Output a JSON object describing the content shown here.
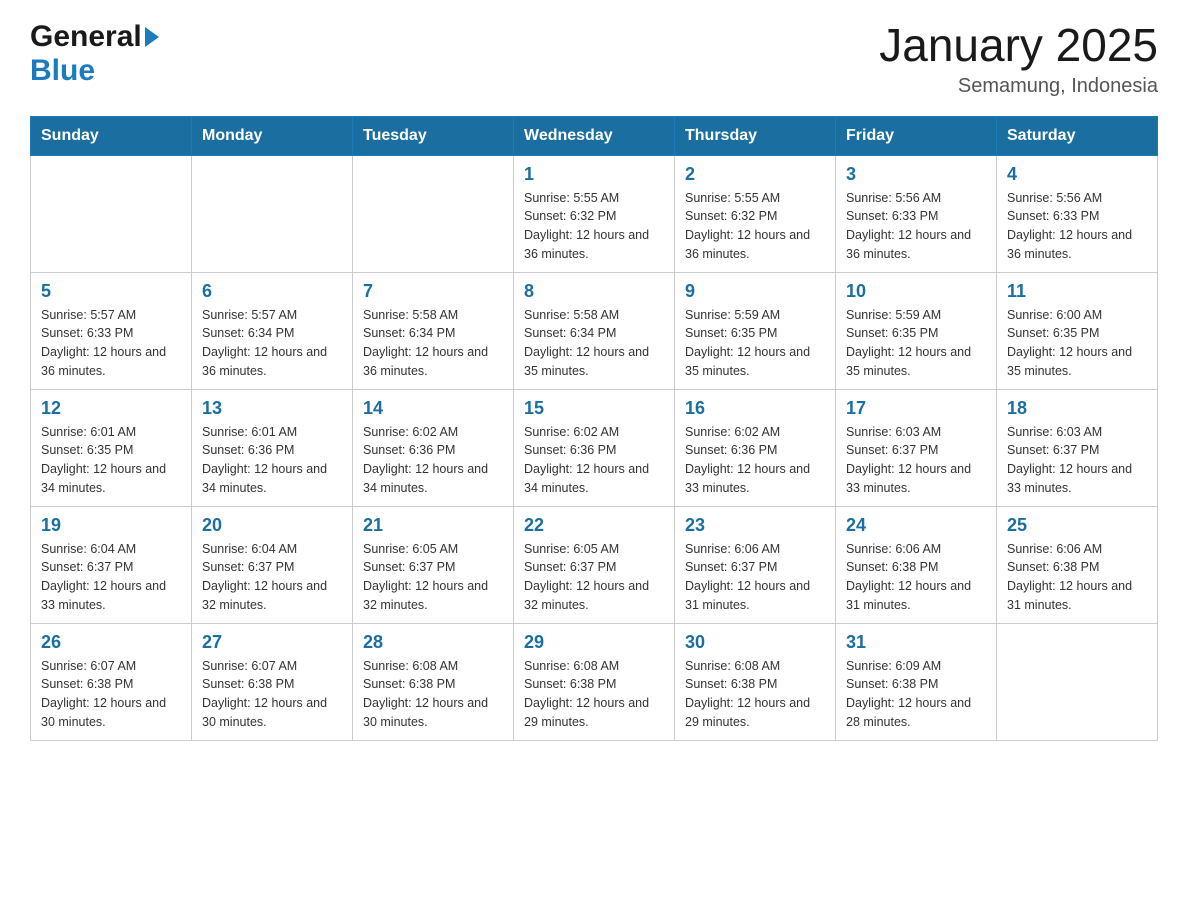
{
  "header": {
    "logo_general": "General",
    "logo_blue": "Blue",
    "title": "January 2025",
    "subtitle": "Semamung, Indonesia"
  },
  "calendar": {
    "days_of_week": [
      "Sunday",
      "Monday",
      "Tuesday",
      "Wednesday",
      "Thursday",
      "Friday",
      "Saturday"
    ],
    "weeks": [
      [
        {
          "day": "",
          "info": ""
        },
        {
          "day": "",
          "info": ""
        },
        {
          "day": "",
          "info": ""
        },
        {
          "day": "1",
          "info": "Sunrise: 5:55 AM\nSunset: 6:32 PM\nDaylight: 12 hours and 36 minutes."
        },
        {
          "day": "2",
          "info": "Sunrise: 5:55 AM\nSunset: 6:32 PM\nDaylight: 12 hours and 36 minutes."
        },
        {
          "day": "3",
          "info": "Sunrise: 5:56 AM\nSunset: 6:33 PM\nDaylight: 12 hours and 36 minutes."
        },
        {
          "day": "4",
          "info": "Sunrise: 5:56 AM\nSunset: 6:33 PM\nDaylight: 12 hours and 36 minutes."
        }
      ],
      [
        {
          "day": "5",
          "info": "Sunrise: 5:57 AM\nSunset: 6:33 PM\nDaylight: 12 hours and 36 minutes."
        },
        {
          "day": "6",
          "info": "Sunrise: 5:57 AM\nSunset: 6:34 PM\nDaylight: 12 hours and 36 minutes."
        },
        {
          "day": "7",
          "info": "Sunrise: 5:58 AM\nSunset: 6:34 PM\nDaylight: 12 hours and 36 minutes."
        },
        {
          "day": "8",
          "info": "Sunrise: 5:58 AM\nSunset: 6:34 PM\nDaylight: 12 hours and 35 minutes."
        },
        {
          "day": "9",
          "info": "Sunrise: 5:59 AM\nSunset: 6:35 PM\nDaylight: 12 hours and 35 minutes."
        },
        {
          "day": "10",
          "info": "Sunrise: 5:59 AM\nSunset: 6:35 PM\nDaylight: 12 hours and 35 minutes."
        },
        {
          "day": "11",
          "info": "Sunrise: 6:00 AM\nSunset: 6:35 PM\nDaylight: 12 hours and 35 minutes."
        }
      ],
      [
        {
          "day": "12",
          "info": "Sunrise: 6:01 AM\nSunset: 6:35 PM\nDaylight: 12 hours and 34 minutes."
        },
        {
          "day": "13",
          "info": "Sunrise: 6:01 AM\nSunset: 6:36 PM\nDaylight: 12 hours and 34 minutes."
        },
        {
          "day": "14",
          "info": "Sunrise: 6:02 AM\nSunset: 6:36 PM\nDaylight: 12 hours and 34 minutes."
        },
        {
          "day": "15",
          "info": "Sunrise: 6:02 AM\nSunset: 6:36 PM\nDaylight: 12 hours and 34 minutes."
        },
        {
          "day": "16",
          "info": "Sunrise: 6:02 AM\nSunset: 6:36 PM\nDaylight: 12 hours and 33 minutes."
        },
        {
          "day": "17",
          "info": "Sunrise: 6:03 AM\nSunset: 6:37 PM\nDaylight: 12 hours and 33 minutes."
        },
        {
          "day": "18",
          "info": "Sunrise: 6:03 AM\nSunset: 6:37 PM\nDaylight: 12 hours and 33 minutes."
        }
      ],
      [
        {
          "day": "19",
          "info": "Sunrise: 6:04 AM\nSunset: 6:37 PM\nDaylight: 12 hours and 33 minutes."
        },
        {
          "day": "20",
          "info": "Sunrise: 6:04 AM\nSunset: 6:37 PM\nDaylight: 12 hours and 32 minutes."
        },
        {
          "day": "21",
          "info": "Sunrise: 6:05 AM\nSunset: 6:37 PM\nDaylight: 12 hours and 32 minutes."
        },
        {
          "day": "22",
          "info": "Sunrise: 6:05 AM\nSunset: 6:37 PM\nDaylight: 12 hours and 32 minutes."
        },
        {
          "day": "23",
          "info": "Sunrise: 6:06 AM\nSunset: 6:37 PM\nDaylight: 12 hours and 31 minutes."
        },
        {
          "day": "24",
          "info": "Sunrise: 6:06 AM\nSunset: 6:38 PM\nDaylight: 12 hours and 31 minutes."
        },
        {
          "day": "25",
          "info": "Sunrise: 6:06 AM\nSunset: 6:38 PM\nDaylight: 12 hours and 31 minutes."
        }
      ],
      [
        {
          "day": "26",
          "info": "Sunrise: 6:07 AM\nSunset: 6:38 PM\nDaylight: 12 hours and 30 minutes."
        },
        {
          "day": "27",
          "info": "Sunrise: 6:07 AM\nSunset: 6:38 PM\nDaylight: 12 hours and 30 minutes."
        },
        {
          "day": "28",
          "info": "Sunrise: 6:08 AM\nSunset: 6:38 PM\nDaylight: 12 hours and 30 minutes."
        },
        {
          "day": "29",
          "info": "Sunrise: 6:08 AM\nSunset: 6:38 PM\nDaylight: 12 hours and 29 minutes."
        },
        {
          "day": "30",
          "info": "Sunrise: 6:08 AM\nSunset: 6:38 PM\nDaylight: 12 hours and 29 minutes."
        },
        {
          "day": "31",
          "info": "Sunrise: 6:09 AM\nSunset: 6:38 PM\nDaylight: 12 hours and 28 minutes."
        },
        {
          "day": "",
          "info": ""
        }
      ]
    ]
  }
}
